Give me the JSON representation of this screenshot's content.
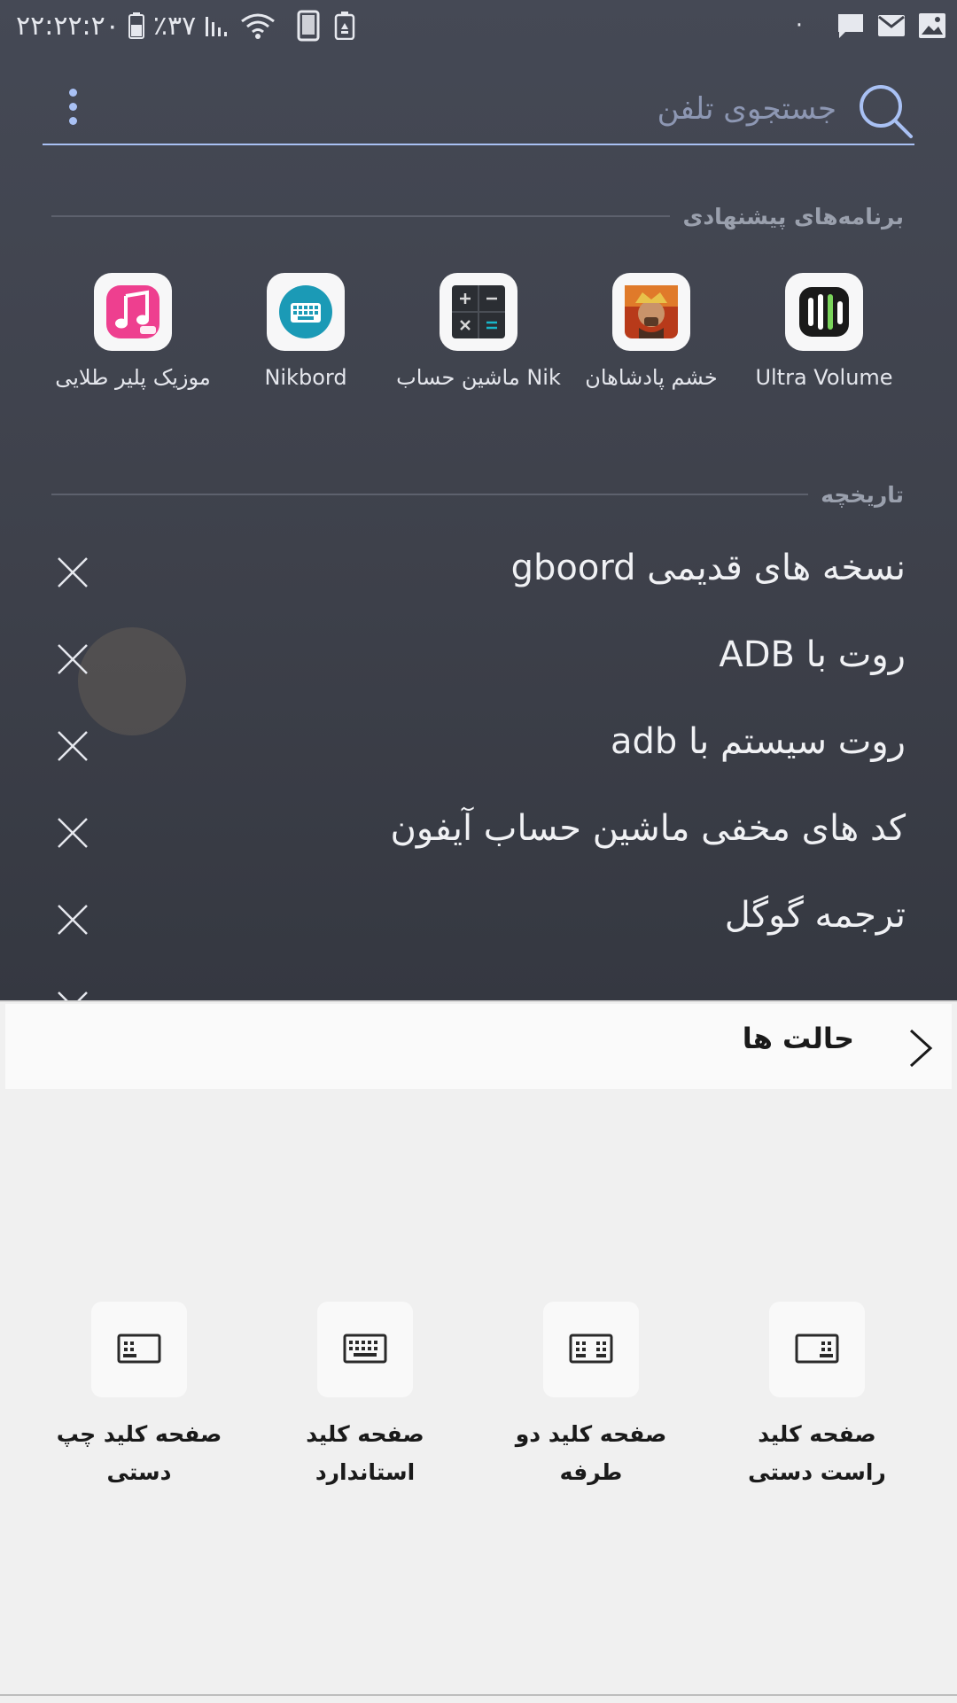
{
  "status_bar": {
    "time": "۲۲:۲۲:۲۰",
    "battery": "٪۳۷",
    "dot": "·"
  },
  "search": {
    "placeholder": "جستجوی تلفن"
  },
  "suggested": {
    "title": "برنامه‌های پیشنهادی",
    "apps": [
      {
        "label": "Ultra Volume",
        "icon": "ultra-volume-icon"
      },
      {
        "label": "خشم پادشاهان",
        "icon": "king-warrior-icon"
      },
      {
        "label": "ماشین حساب Nik",
        "icon": "calculator-icon"
      },
      {
        "label": "Nikbord",
        "icon": "keyboard-icon"
      },
      {
        "label": "موزیک پلیر طلایی",
        "icon": "music-note-icon",
        "badge": "music"
      }
    ]
  },
  "history": {
    "title": "تاریخچه",
    "items": [
      "نسخه های قدیمی gboord",
      "روت با ADB",
      "روت سیستم با adb",
      "کد های مخفی ماشین حساب آیفون",
      "ترجمه گوگل"
    ]
  },
  "modes": {
    "title": "حالت ها",
    "options": [
      {
        "line1": "صفحه کلید",
        "line2": "راست دستی",
        "icon": "keyboard-right-hand-icon"
      },
      {
        "line1": "صفحه کلید دو",
        "line2": "طرفه",
        "icon": "keyboard-split-icon"
      },
      {
        "line1": "صفحه کلید",
        "line2": "استاندارد",
        "icon": "keyboard-standard-icon"
      },
      {
        "line1": "صفحه کلید چپ",
        "line2": "دستی",
        "icon": "keyboard-left-hand-icon"
      }
    ]
  },
  "colors": {
    "accent": "#a9c1f4",
    "dark_bg": "#3e414b",
    "panel_bg": "#f0f0f0"
  }
}
